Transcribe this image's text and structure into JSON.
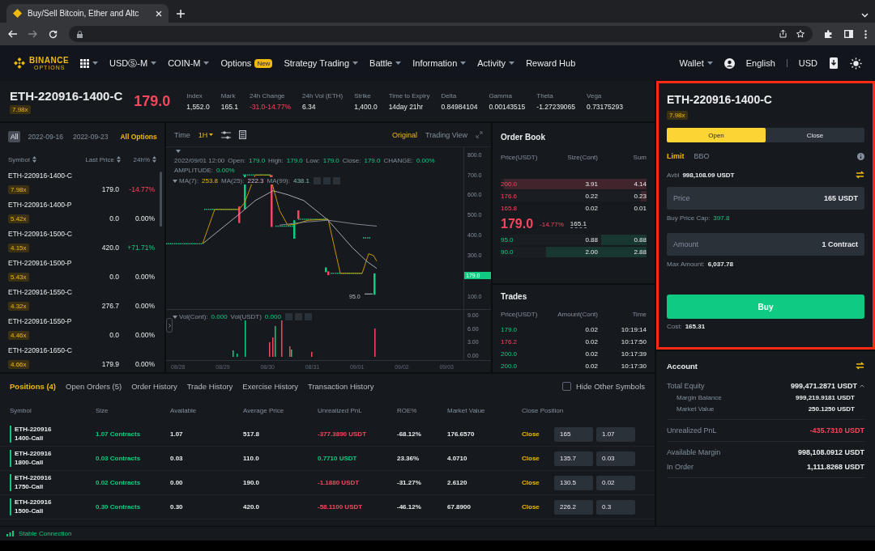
{
  "browser": {
    "tab_title": "Buy/Sell Bitcoin, Ether and Altc"
  },
  "nav": {
    "logo": "BINANCE",
    "logo_sub": "OPTIONS",
    "items": [
      {
        "label": "USDⓈ-M",
        "dropdown": true
      },
      {
        "label": "COIN-M",
        "dropdown": true
      },
      {
        "label": "Options",
        "dropdown": false,
        "badge": "New"
      },
      {
        "label": "Strategy Trading",
        "dropdown": true
      },
      {
        "label": "Battle",
        "dropdown": true
      },
      {
        "label": "Information",
        "dropdown": true
      },
      {
        "label": "Activity",
        "dropdown": true
      },
      {
        "label": "Reward Hub",
        "dropdown": false
      }
    ],
    "wallet": "Wallet",
    "language": "English",
    "currency": "USD"
  },
  "ticker": {
    "symbol": "ETH-220916-1400-C",
    "leverage": "7.98x",
    "price": "179.0",
    "stats": [
      {
        "label": "Index",
        "value": "1,552.0",
        "kind": "plain"
      },
      {
        "label": "Mark",
        "value": "165.1",
        "kind": "plain"
      },
      {
        "label": "24h Change",
        "value": "-31.0-14.77%",
        "kind": "loss"
      },
      {
        "label": "24h Vol (ETH)",
        "value": "6.34",
        "kind": "plain"
      },
      {
        "label": "Strike",
        "value": "1,400.0",
        "kind": "plain"
      },
      {
        "label": "Time to Expiry",
        "value": "14day 21hr",
        "kind": "plain"
      },
      {
        "label": "Delta",
        "value": "0.84984104",
        "kind": "plain"
      },
      {
        "label": "Gamma",
        "value": "0.00143515",
        "kind": "plain"
      },
      {
        "label": "Theta",
        "value": "-1.27239065",
        "kind": "plain"
      },
      {
        "label": "Vega",
        "value": "0.73175293",
        "kind": "plain"
      }
    ]
  },
  "options_list": {
    "filters": [
      {
        "label": "All",
        "selected": true
      },
      {
        "label": "2022-09-16",
        "selected": false
      },
      {
        "label": "2022-09-23",
        "selected": false
      }
    ],
    "all_options": "All Options",
    "columns": [
      "Symbol",
      "Last Price",
      "24h%"
    ],
    "rows": [
      {
        "symbol": "ETH-220916-1400-C",
        "leverage": "7.98x",
        "price": "179.0",
        "change": "-14.77%",
        "kind": "loss"
      },
      {
        "symbol": "ETH-220916-1400-P",
        "leverage": "5.42x",
        "price": "0.0",
        "change": "0.00%",
        "kind": "plain"
      },
      {
        "symbol": "ETH-220916-1500-C",
        "leverage": "4.15x",
        "price": "420.0",
        "change": "+71.71%",
        "kind": "gain"
      },
      {
        "symbol": "ETH-220916-1500-P",
        "leverage": "5.43x",
        "price": "0.0",
        "change": "0.00%",
        "kind": "plain"
      },
      {
        "symbol": "ETH-220916-1550-C",
        "leverage": "4.32x",
        "price": "276.7",
        "change": "0.00%",
        "kind": "plain"
      },
      {
        "symbol": "ETH-220916-1550-P",
        "leverage": "4.46x",
        "price": "0.0",
        "change": "0.00%",
        "kind": "plain"
      },
      {
        "symbol": "ETH-220916-1650-C",
        "leverage": "4.66x",
        "price": "179.9",
        "change": "0.00%",
        "kind": "plain"
      }
    ]
  },
  "chart": {
    "time_label": "Time",
    "interval": "1H",
    "views": [
      {
        "label": "Original",
        "selected": true
      },
      {
        "label": "Trading View",
        "selected": false
      }
    ],
    "info_line": [
      {
        "text": "2022/09/01 12:00",
        "kind": "label"
      },
      {
        "text": "Open:",
        "kind": "label"
      },
      {
        "text": "179.0",
        "kind": "gain"
      },
      {
        "text": "High:",
        "kind": "label"
      },
      {
        "text": "179.0",
        "kind": "gain"
      },
      {
        "text": "Low:",
        "kind": "label"
      },
      {
        "text": "179.0",
        "kind": "gain"
      },
      {
        "text": "Close:",
        "kind": "label"
      },
      {
        "text": "179.0",
        "kind": "gain"
      },
      {
        "text": "CHANGE:",
        "kind": "label"
      },
      {
        "text": "0.00%",
        "kind": "gain"
      }
    ],
    "amplitude_line": [
      {
        "text": "AMPLITUDE:",
        "kind": "label"
      },
      {
        "text": "0.00%",
        "kind": "gain"
      }
    ],
    "ma_line": [
      {
        "text": "MA(7):",
        "kind": "label"
      },
      {
        "text": "253.8",
        "kind": "ma7"
      },
      {
        "text": "MA(25):",
        "kind": "label"
      },
      {
        "text": "222.3",
        "kind": "ma25"
      },
      {
        "text": "MA(99):",
        "kind": "label"
      },
      {
        "text": "438.1",
        "kind": "ma99"
      }
    ],
    "vol_line": [
      {
        "text": "Vol(Cont):",
        "kind": "label"
      },
      {
        "text": "0.000",
        "kind": "gain"
      },
      {
        "text": "Vol(USDT)",
        "kind": "label"
      },
      {
        "text": "0.000",
        "kind": "gain"
      }
    ],
    "price_axis": [
      {
        "label": "800.0",
        "kind": "tick"
      },
      {
        "label": "700.0",
        "kind": "tick"
      },
      {
        "label": "600.0",
        "kind": "tick"
      },
      {
        "label": "500.0",
        "kind": "tick"
      },
      {
        "label": "400.0",
        "kind": "tick"
      },
      {
        "label": "300.0",
        "kind": "tick"
      },
      {
        "label": "179.0",
        "kind": "current"
      },
      {
        "label": "100.0",
        "kind": "tick"
      }
    ],
    "volume_axis": [
      "9.00",
      "6.00",
      "3.00",
      "0.00"
    ],
    "date_axis": [
      "08/28",
      "08/29",
      "08/30",
      "08/31",
      "09/01",
      "09/02",
      "09/03"
    ],
    "low_marker": "95.0"
  },
  "order_book": {
    "title": "Order Book",
    "columns": [
      "Price(USDT)",
      "Size(Cont)",
      "Sum"
    ],
    "asks": [
      {
        "price": "200.0",
        "size": "3.91",
        "sum": "4.14",
        "level": 0.98
      },
      {
        "price": "176.6",
        "size": "0.22",
        "sum": "0.23",
        "level": 0.04
      },
      {
        "price": "165.8",
        "size": "0.02",
        "sum": "0.01"
      }
    ],
    "last_price": "179.0",
    "last_change": "-14.77%",
    "mark_price": "165.1",
    "bids": [
      {
        "price": "95.0",
        "size": "0.88",
        "sum": "0.88",
        "level": 0.31
      },
      {
        "price": "90.0",
        "size": "2.00",
        "sum": "2.88",
        "level": 0.69
      }
    ]
  },
  "trades": {
    "title": "Trades",
    "columns": [
      "Price(USDT)",
      "Amount(Cont)",
      "Time"
    ],
    "rows": [
      {
        "price": "179.0",
        "amount": "0.02",
        "time": "10:19:14",
        "kind": "gain"
      },
      {
        "price": "176.2",
        "amount": "0.02",
        "time": "10:17:50",
        "kind": "loss"
      },
      {
        "price": "200.0",
        "amount": "0.02",
        "time": "10:17:39",
        "kind": "gain"
      },
      {
        "price": "200.0",
        "amount": "0.02",
        "time": "10:17:30",
        "kind": "gain"
      }
    ]
  },
  "order_panel": {
    "highlighted": true,
    "symbol": "ETH-220916-1400-C",
    "leverage": "7.98x",
    "sides": [
      {
        "label": "Open",
        "selected": true
      },
      {
        "label": "Close",
        "selected": false
      }
    ],
    "order_types": [
      {
        "label": "Limit",
        "selected": true
      },
      {
        "label": "BBO",
        "selected": false
      }
    ],
    "avbl_label": "Avbl",
    "avbl": "998,108.09 USDT",
    "price_field": {
      "label": "Price",
      "value": "165 USDT"
    },
    "cap_label": "Buy Price Cap:",
    "cap": "397.8",
    "amount_field": {
      "label": "Amount",
      "value": "1 Contract"
    },
    "max_label": "Max Amount:",
    "max": "6,037.78",
    "button": "Buy",
    "cost_label": "Cost:",
    "cost": "165.31"
  },
  "account": {
    "title": "Account",
    "sections": [
      {
        "rows": [
          {
            "label": "Total Equity",
            "value": "999,471.2871 USDT",
            "kind": "plain",
            "expanded": true,
            "children": [
              {
                "label": "Margin Balance",
                "value": "999,219.9181 USDT"
              },
              {
                "label": "Market Value",
                "value": "250.1250 USDT"
              }
            ]
          }
        ]
      },
      {
        "rows": [
          {
            "label": "Unrealized PnL",
            "value": "-435.7310 USDT",
            "kind": "loss"
          }
        ]
      },
      {
        "rows": [
          {
            "label": "Available Margin",
            "value": "998,108.0912 USDT",
            "kind": "plain"
          },
          {
            "label": "In Order",
            "value": "1,111.8268 USDT",
            "kind": "plain"
          }
        ]
      }
    ]
  },
  "positions": {
    "tabs": [
      {
        "label": "Positions (4)",
        "selected": true
      },
      {
        "label": "Open Orders (5)",
        "selected": false
      },
      {
        "label": "Order History",
        "selected": false
      },
      {
        "label": "Trade History",
        "selected": false
      },
      {
        "label": "Exercise History",
        "selected": false
      },
      {
        "label": "Transaction History",
        "selected": false
      }
    ],
    "hide_other": {
      "label": "Hide Other Symbols",
      "checked": false
    },
    "columns": [
      "Symbol",
      "Size",
      "Available",
      "Average Price",
      "Unrealized PnL",
      "ROE%",
      "Market Value",
      "Close Position"
    ],
    "rows": [
      {
        "symbol": "ETH-220916 1400-Call",
        "size": "1.07 Contracts",
        "available": "1.07",
        "average": "517.8",
        "pnl": "-377.3890 USDT",
        "kind": "loss",
        "roe": "-68.12%",
        "market_value": "176.6570",
        "close": "Close",
        "close_price": "165",
        "close_amount": "1.07"
      },
      {
        "symbol": "ETH-220916 1800-Call",
        "size": "0.03 Contracts",
        "available": "0.03",
        "average": "110.0",
        "pnl": "0.7710 USDT",
        "kind": "gain",
        "roe": "23.36%",
        "market_value": "4.0710",
        "close": "Close",
        "close_price": "135.7",
        "close_amount": "0.03"
      },
      {
        "symbol": "ETH-220916 1750-Call",
        "size": "0.02 Contracts",
        "available": "0.00",
        "average": "190.0",
        "pnl": "-1.1880 USDT",
        "kind": "loss",
        "roe": "-31.27%",
        "market_value": "2.6120",
        "close": "Close",
        "close_price": "130.5",
        "close_amount": "0.02"
      },
      {
        "symbol": "ETH-220916 1500-Call",
        "size": "0.30 Contracts",
        "available": "0.30",
        "average": "420.0",
        "pnl": "-58.1100 USDT",
        "kind": "loss",
        "roe": "-46.12%",
        "market_value": "67.8900",
        "close": "Close",
        "close_price": "226.2",
        "close_amount": "0.3"
      }
    ]
  },
  "status_bar": {
    "connection": "Stable Connection"
  }
}
